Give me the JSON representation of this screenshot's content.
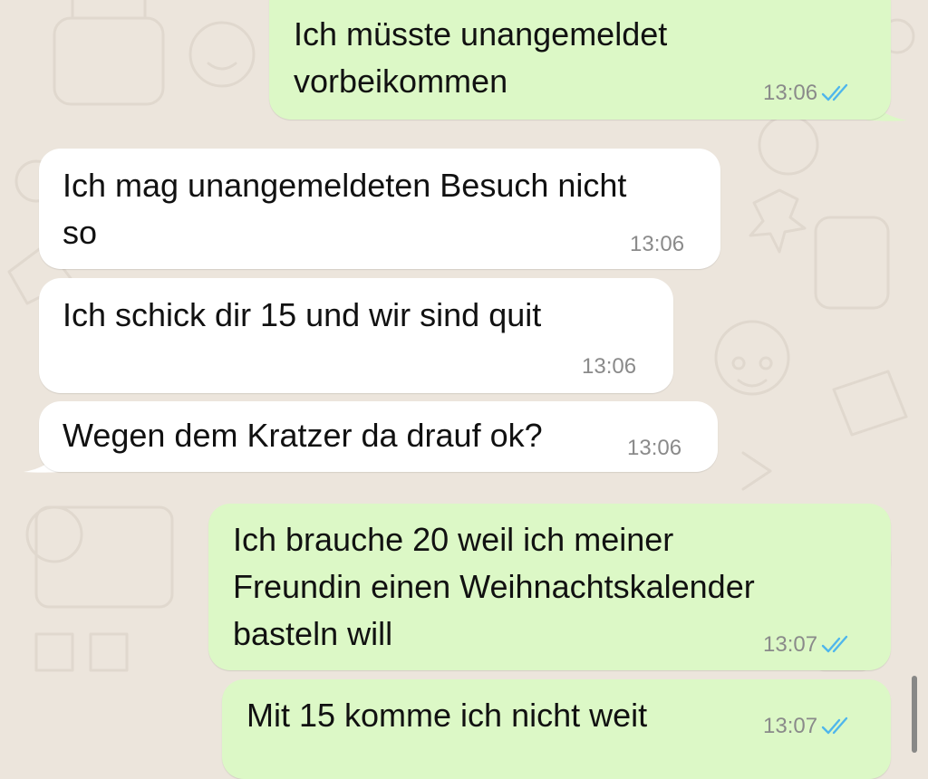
{
  "messages": [
    {
      "direction": "outgoing",
      "text": "Ich müsste unangemeldet\nvorbeikommen",
      "time": "13:06",
      "status_icon": "double-check-read-icon"
    },
    {
      "direction": "incoming",
      "text": "Ich mag unangemeldeten Besuch nicht\nso",
      "time": "13:06"
    },
    {
      "direction": "incoming",
      "text": "Ich schick dir 15 und wir sind quit",
      "time": "13:06"
    },
    {
      "direction": "incoming",
      "text": "Wegen dem Kratzer da drauf ok?",
      "time": "13:06"
    },
    {
      "direction": "outgoing",
      "text": "Ich brauche 20 weil ich meiner\nFreundin einen Weihnachtskalender\nbasteln will",
      "time": "13:07",
      "status_icon": "double-check-read-icon"
    },
    {
      "direction": "outgoing",
      "text": "Mit 15 komme ich nicht weit",
      "time": "13:07",
      "status_icon": "double-check-read-icon"
    }
  ],
  "colors": {
    "background": "#ece5dc",
    "incoming_bubble": "#ffffff",
    "outgoing_bubble": "#dcf8c6",
    "read_ticks": "#4fb6ec",
    "timestamp": "#8a8a8a"
  }
}
